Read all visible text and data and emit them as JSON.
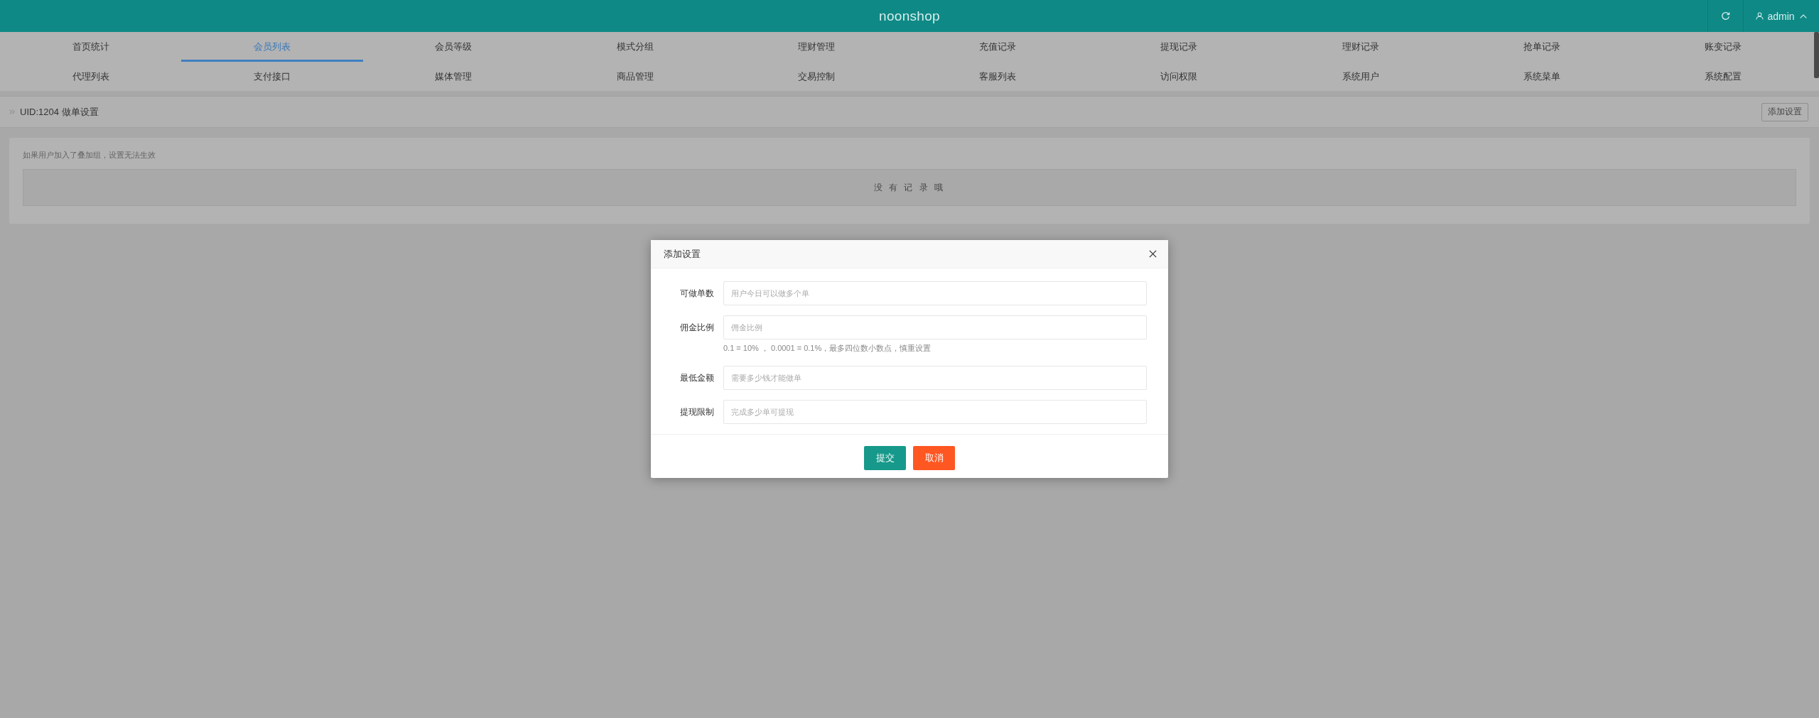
{
  "header": {
    "title": "noonshop",
    "user": "admin"
  },
  "nav": {
    "rows": [
      {
        "items": [
          {
            "label": "首页统计",
            "selected": false
          },
          {
            "label": "会员列表",
            "selected": true
          },
          {
            "label": "会员等级",
            "selected": false
          },
          {
            "label": "模式分组",
            "selected": false
          },
          {
            "label": "理财管理",
            "selected": false
          },
          {
            "label": "充值记录",
            "selected": false
          },
          {
            "label": "提现记录",
            "selected": false
          },
          {
            "label": "理财记录",
            "selected": false
          },
          {
            "label": "抢单记录",
            "selected": false
          },
          {
            "label": "账变记录",
            "selected": false
          }
        ]
      },
      {
        "items": [
          {
            "label": "代理列表",
            "selected": false
          },
          {
            "label": "支付接口",
            "selected": false
          },
          {
            "label": "媒体管理",
            "selected": false
          },
          {
            "label": "商品管理",
            "selected": false
          },
          {
            "label": "交易控制",
            "selected": false
          },
          {
            "label": "客服列表",
            "selected": false
          },
          {
            "label": "访问权限",
            "selected": false
          },
          {
            "label": "系统用户",
            "selected": false
          },
          {
            "label": "系统菜单",
            "selected": false
          },
          {
            "label": "系统配置",
            "selected": false
          }
        ]
      }
    ]
  },
  "breadcrumb": {
    "title": "UID:1204 做单设置",
    "add_button": "添加设置"
  },
  "card": {
    "notice": "如果用户加入了叠加组，设置无法生效",
    "empty_message": "没 有 记 录 哦"
  },
  "dialog": {
    "title": "添加设置",
    "fields": [
      {
        "label": "可做单数",
        "placeholder": "用户今日可以做多个单"
      },
      {
        "label": "佣金比例",
        "placeholder": "佣金比例",
        "hint": "0.1 = 10% ， 0.0001 = 0.1%，最多四位数小数点，慎重设置"
      },
      {
        "label": "最低金额",
        "placeholder": "需要多少钱才能做单"
      },
      {
        "label": "提现限制",
        "placeholder": "完成多少单可提现"
      }
    ],
    "buttons": [
      {
        "label": "提交",
        "kind": "primary"
      },
      {
        "label": "取消",
        "kind": "danger"
      }
    ]
  }
}
